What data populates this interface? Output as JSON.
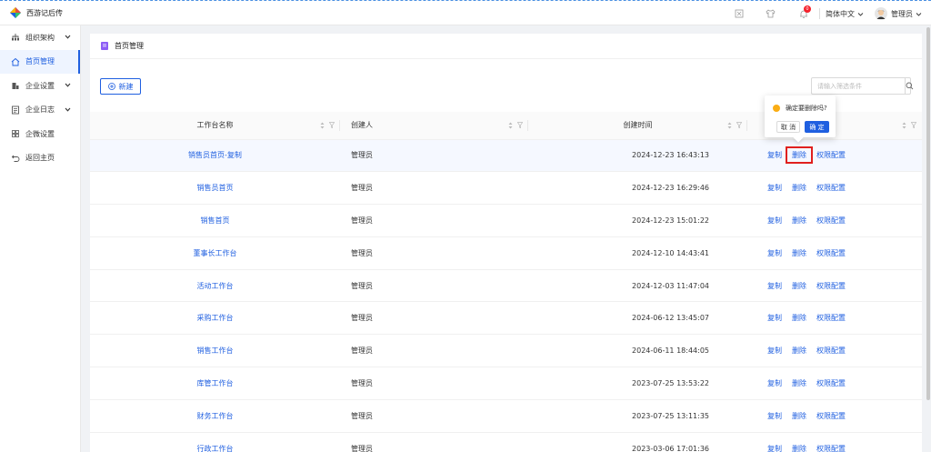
{
  "app": {
    "title": "西游记后传",
    "brand_colors": [
      "#e84d3d",
      "#f7b500",
      "#1f5fe0",
      "#36c46a"
    ]
  },
  "header": {
    "language": "简体中文",
    "user_name": "管理员",
    "notification_count": "0",
    "icons": [
      "fullscreen-icon",
      "shirt-icon",
      "bell-icon"
    ]
  },
  "sidebar": {
    "items": [
      {
        "label": "组织架构",
        "icon": "org-chart-icon",
        "expandable": true,
        "active": false
      },
      {
        "label": "首页管理",
        "icon": "home-icon",
        "expandable": false,
        "active": true
      },
      {
        "label": "企业设置",
        "icon": "building-icon",
        "expandable": true,
        "active": false
      },
      {
        "label": "企业日志",
        "icon": "log-icon",
        "expandable": true,
        "active": false
      },
      {
        "label": "企微设置",
        "icon": "grid-icon",
        "expandable": false,
        "active": false
      },
      {
        "label": "返回主页",
        "icon": "return-icon",
        "expandable": false,
        "active": false
      }
    ]
  },
  "page": {
    "title": "首页管理",
    "new_button": "新建",
    "search_placeholder": "请输入筛选条件"
  },
  "table": {
    "columns": [
      "工作台名称",
      "创建人",
      "创建时间",
      ""
    ],
    "actions": [
      "复制",
      "删除",
      "权限配置"
    ],
    "rows": [
      {
        "name": "销售员首页-复制",
        "creator": "管理员",
        "time": "2024-12-23 16:43:13"
      },
      {
        "name": "销售员首页",
        "creator": "管理员",
        "time": "2024-12-23 16:29:46"
      },
      {
        "name": "销售首页",
        "creator": "管理员",
        "time": "2024-12-23 15:01:22"
      },
      {
        "name": "董事长工作台",
        "creator": "管理员",
        "time": "2024-12-10 14:43:41"
      },
      {
        "name": "活动工作台",
        "creator": "管理员",
        "time": "2024-12-03 11:47:04"
      },
      {
        "name": "采购工作台",
        "creator": "管理员",
        "time": "2024-06-12 13:45:07"
      },
      {
        "name": "销售工作台",
        "creator": "管理员",
        "time": "2024-06-11 18:44:05"
      },
      {
        "name": "库管工作台",
        "creator": "管理员",
        "time": "2023-07-25 13:53:22"
      },
      {
        "name": "财务工作台",
        "creator": "管理员",
        "time": "2023-07-25 13:11:35"
      },
      {
        "name": "行政工作台",
        "creator": "管理员",
        "time": "2023-03-06 17:01:36"
      }
    ]
  },
  "popconfirm": {
    "message": "确定要删除吗?",
    "cancel": "取 消",
    "ok": "确 定"
  },
  "colors": {
    "primary": "#1f5fe0",
    "highlight_outline": "#e0201e",
    "warning": "#faad14"
  }
}
